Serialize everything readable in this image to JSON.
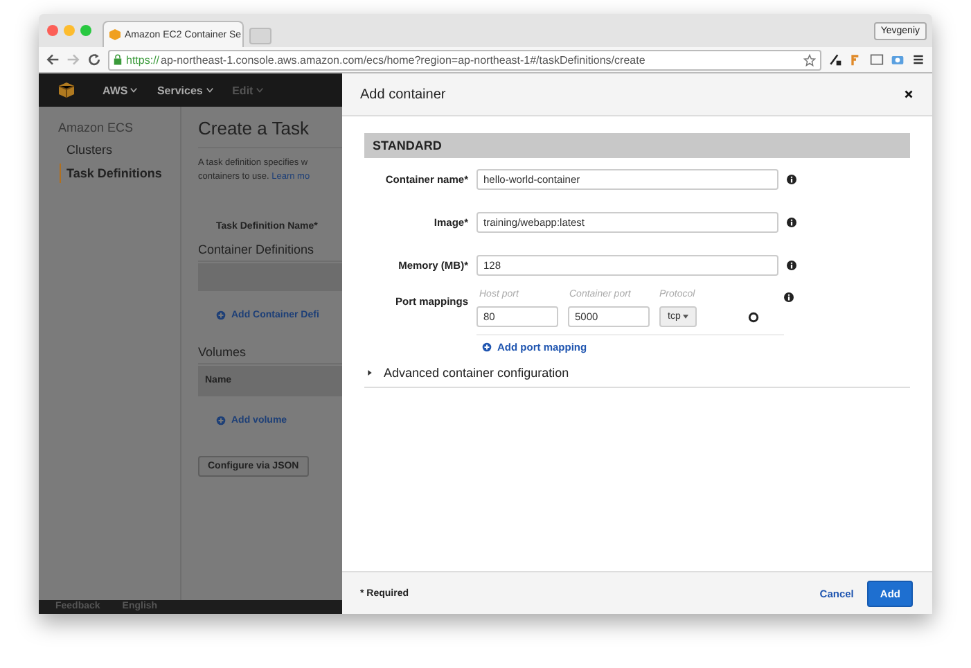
{
  "browser": {
    "tab_title": "Amazon EC2 Container Se",
    "profile": "Yevgeniy",
    "url_scheme": "https://",
    "url_rest": "ap-northeast-1.console.aws.amazon.com/ecs/home?region=ap-northeast-1#/taskDefinitions/create"
  },
  "aws_nav": [
    {
      "label": "AWS",
      "disabled": false
    },
    {
      "label": "Services",
      "disabled": false
    },
    {
      "label": "Edit",
      "disabled": true
    }
  ],
  "sidebar": {
    "heading": "Amazon ECS",
    "items": [
      {
        "label": "Clusters",
        "selected": false
      },
      {
        "label": "Task Definitions",
        "selected": true
      }
    ]
  },
  "page": {
    "title": "Create a Task",
    "description": "A task definition specifies w containers to use.",
    "learn_more": "Learn mo",
    "name_label": "Task Definition Name*",
    "container_definitions": "Container Definitions",
    "add_container": "Add Container Defi",
    "volumes": "Volumes",
    "volumes_column": "Name",
    "add_volume": "Add volume",
    "configure_json": "Configure via JSON"
  },
  "footer": [
    "Feedback",
    "English"
  ],
  "modal": {
    "title": "Add container",
    "section": "STANDARD",
    "fields": [
      {
        "label": "Container name*",
        "value": "hello-world-container"
      },
      {
        "label": "Image*",
        "value": "training/webapp:latest"
      },
      {
        "label": "Memory (MB)*",
        "value": "128"
      }
    ],
    "port_mappings": {
      "label": "Port mappings",
      "host_placeholder": "Host port",
      "container_placeholder": "Container port",
      "protocol_label": "Protocol",
      "rows": [
        {
          "host": "80",
          "container": "5000",
          "protocol": "tcp"
        }
      ],
      "add": "Add port mapping"
    },
    "advanced": {
      "label": "Advanced container configuration",
      "expanded": false
    },
    "required_note": "* Required",
    "cancel": "Cancel",
    "add": "Add"
  }
}
